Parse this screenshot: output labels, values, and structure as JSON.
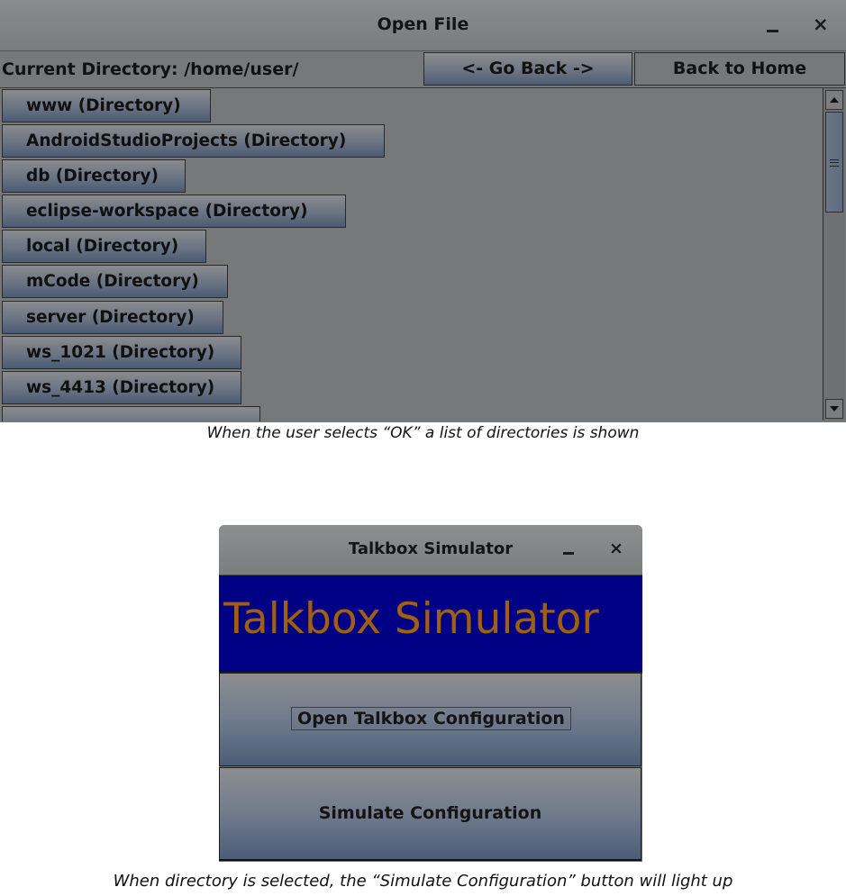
{
  "open_file_window": {
    "title": "Open File",
    "controls": {
      "minimize": "minimize-icon",
      "close": "×"
    },
    "current_directory": "Current Directory: /home/user/",
    "go_back_label": "<- Go Back ->",
    "back_to_home_label": "Back to Home",
    "entries": [
      "www (Directory)",
      "AndroidStudioProjects (Directory)",
      "db (Directory)",
      "eclipse-workspace (Directory)",
      "local (Directory)",
      "mCode (Directory)",
      "server (Directory)",
      "ws_1021 (Directory)",
      "ws_4413 (Directory)"
    ]
  },
  "caption_1": "When the user selects “OK” a list of directories is shown",
  "talkbox_window": {
    "title": "Talkbox Simulator",
    "controls": {
      "minimize": "minimize-icon",
      "close": "×"
    },
    "banner_text": "Talkbox Simulator",
    "banner_bg": "#000085",
    "banner_fg": "#a0600e",
    "open_config_label": "Open Talkbox Configuration",
    "simulate_label": "Simulate Configuration"
  },
  "caption_2": "When directory is selected, the “Simulate Configuration” button will light up"
}
